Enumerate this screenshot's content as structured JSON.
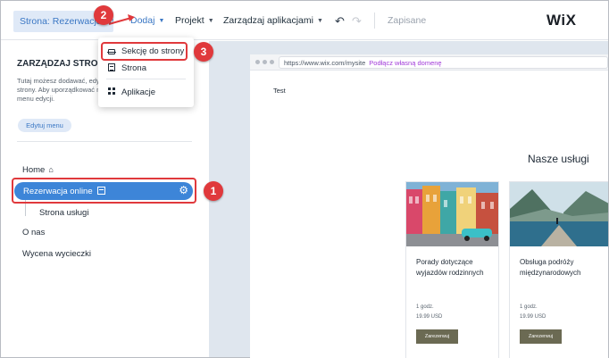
{
  "topbar": {
    "page_select": "Strona: Rezerwacja online",
    "menu_add": "Dodaj",
    "menu_project": "Projekt",
    "menu_apps": "Zarządzaj aplikacjami",
    "saved_status": "Zapisane",
    "logo": "WiX"
  },
  "add_dropdown": {
    "items": [
      {
        "label": "Sekcję do strony",
        "icon": "sections-icon"
      },
      {
        "label": "Strona",
        "icon": "page-icon"
      },
      {
        "label": "Aplikacje",
        "icon": "apps-grid-icon"
      }
    ]
  },
  "left_panel": {
    "title": "ZARZĄDZAJ STRONAMI",
    "description_lines": [
      "Tutaj możesz dodawać, edytować i usuwać",
      "strony. Aby uporządkować menu, przejdź do",
      "menu edycji."
    ],
    "edit_menu_button": "Edytuj menu",
    "nav": {
      "home": "Home",
      "selected": "Rezerwacja online",
      "sub_page": "Strona usługi",
      "about": "O nas",
      "trip": "Wycena wycieczki"
    }
  },
  "preview": {
    "url": "https://www.wix.com/mysite",
    "connect_domain": "Podłącz własną domenę",
    "test_text": "Test",
    "services_title": "Nasze usługi",
    "cards": [
      {
        "title": "Porady dotyczące wyjazdów rodzinnych",
        "duration": "1 godz.",
        "price": "19.99 USD",
        "button": "Zarezerwuj"
      },
      {
        "title": "Obsługa podróży międzynarodowych",
        "duration": "1 godz.",
        "price": "19.99 USD",
        "button": "Zarezerwuj"
      }
    ]
  },
  "callouts": {
    "step1": "1",
    "step2": "2",
    "step3": "3"
  },
  "colors": {
    "accent": "#3d85d8",
    "callout": "#e0393c",
    "book_button": "#6b6a53",
    "connect_domain": "#a13ad9"
  }
}
